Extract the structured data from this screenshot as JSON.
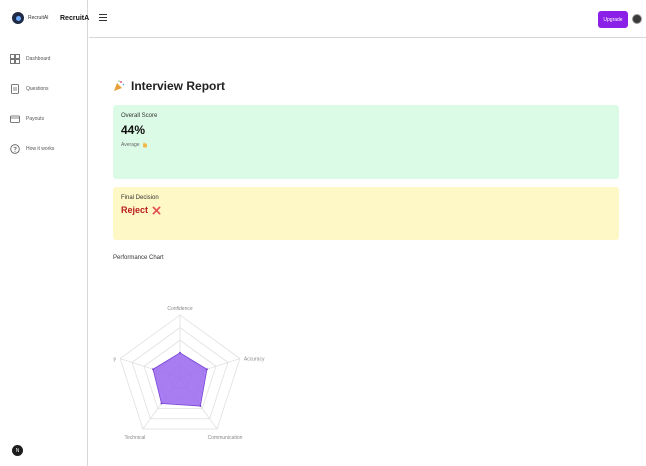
{
  "brand": {
    "small_name": "RecruitAI",
    "name": "RecruitAI"
  },
  "sidebar": {
    "items": [
      {
        "label": "Dashboard",
        "icon": "dashboard-icon"
      },
      {
        "label": "Questions",
        "icon": "document-icon"
      },
      {
        "label": "Payouts",
        "icon": "wallet-icon"
      },
      {
        "label": "How it works",
        "icon": "help-circle-icon"
      }
    ],
    "user_initial": "N"
  },
  "topbar": {
    "upgrade_label": "Upgrade"
  },
  "report": {
    "title": "Interview Report",
    "overall_label": "Overall Score",
    "overall_value": "44%",
    "overall_rating": "Average",
    "decision_label": "Final Decision",
    "decision_value": "Reject"
  },
  "colors": {
    "accent": "#8b21e8",
    "score_bg": "#dcfbe6",
    "decision_bg": "#fef7c6",
    "reject": "#b71c1c",
    "radar_fill": "#9966ee"
  },
  "chart_data": {
    "type": "radar",
    "title": "Performance Chart",
    "axes": [
      "Confidence",
      "Accuracy",
      "Communication",
      "Technical",
      "Fluency"
    ],
    "max": 100,
    "series": [
      {
        "values": [
          40,
          45,
          55,
          50,
          45
        ]
      }
    ]
  }
}
